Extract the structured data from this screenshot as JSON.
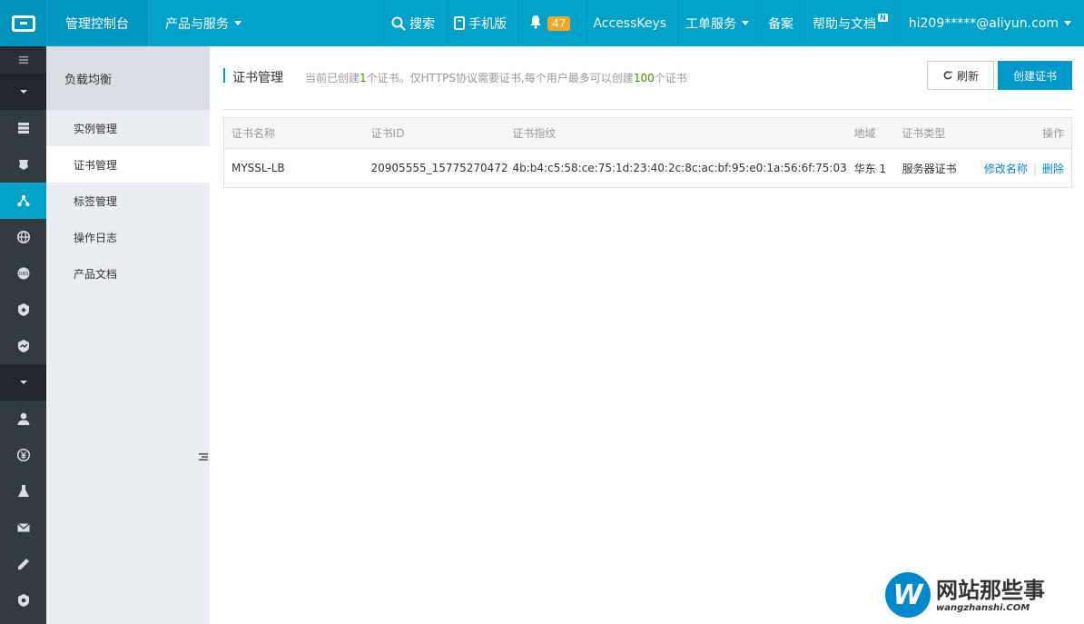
{
  "topbar": {
    "console": "管理控制台",
    "products": "产品与服务",
    "search": "搜索",
    "mobile": "手机版",
    "notifications_count": "47",
    "access_keys": "AccessKeys",
    "tickets": "工单服务",
    "filing": "备案",
    "help": "帮助与文档",
    "help_badge": "N",
    "user": "hi209*****@aliyun.com"
  },
  "sidebar": {
    "title": "负载均衡",
    "items": [
      {
        "label": "实例管理"
      },
      {
        "label": "证书管理"
      },
      {
        "label": "标签管理"
      },
      {
        "label": "操作日志"
      },
      {
        "label": "产品文档"
      }
    ]
  },
  "page": {
    "title": "证书管理",
    "subtitle_pre": "当前已创建",
    "subtitle_count": "1",
    "subtitle_mid": "个证书。仅HTTPS协议需要证书,每个用户最多可以创建",
    "subtitle_max": "100",
    "subtitle_post": "个证书",
    "refresh_label": "刷新",
    "create_label": "创建证书"
  },
  "table": {
    "headers": [
      "证书名称",
      "证书ID",
      "证书指纹",
      "地域",
      "证书类型",
      "操作"
    ],
    "rows": [
      {
        "name": "MYSSL-LB",
        "id": "20905555_15775270472",
        "fingerprint": "4b:b4:c5:58:ce:75:1d:23:40:2c:8c:ac:bf:95:e0:1a:56:6f:75:03",
        "region": "华东 1",
        "type": "服务器证书",
        "action_rename": "修改名称",
        "action_separator": "|",
        "action_delete": "删除"
      }
    ]
  },
  "watermark": {
    "letter": "W",
    "cn": "网站那些事",
    "en": "wangzhanshi.COM"
  },
  "colors": {
    "topbar": "#00a2ca",
    "rail": "#333a40",
    "accent": "#0099cc",
    "highlight_green": "#339900"
  }
}
